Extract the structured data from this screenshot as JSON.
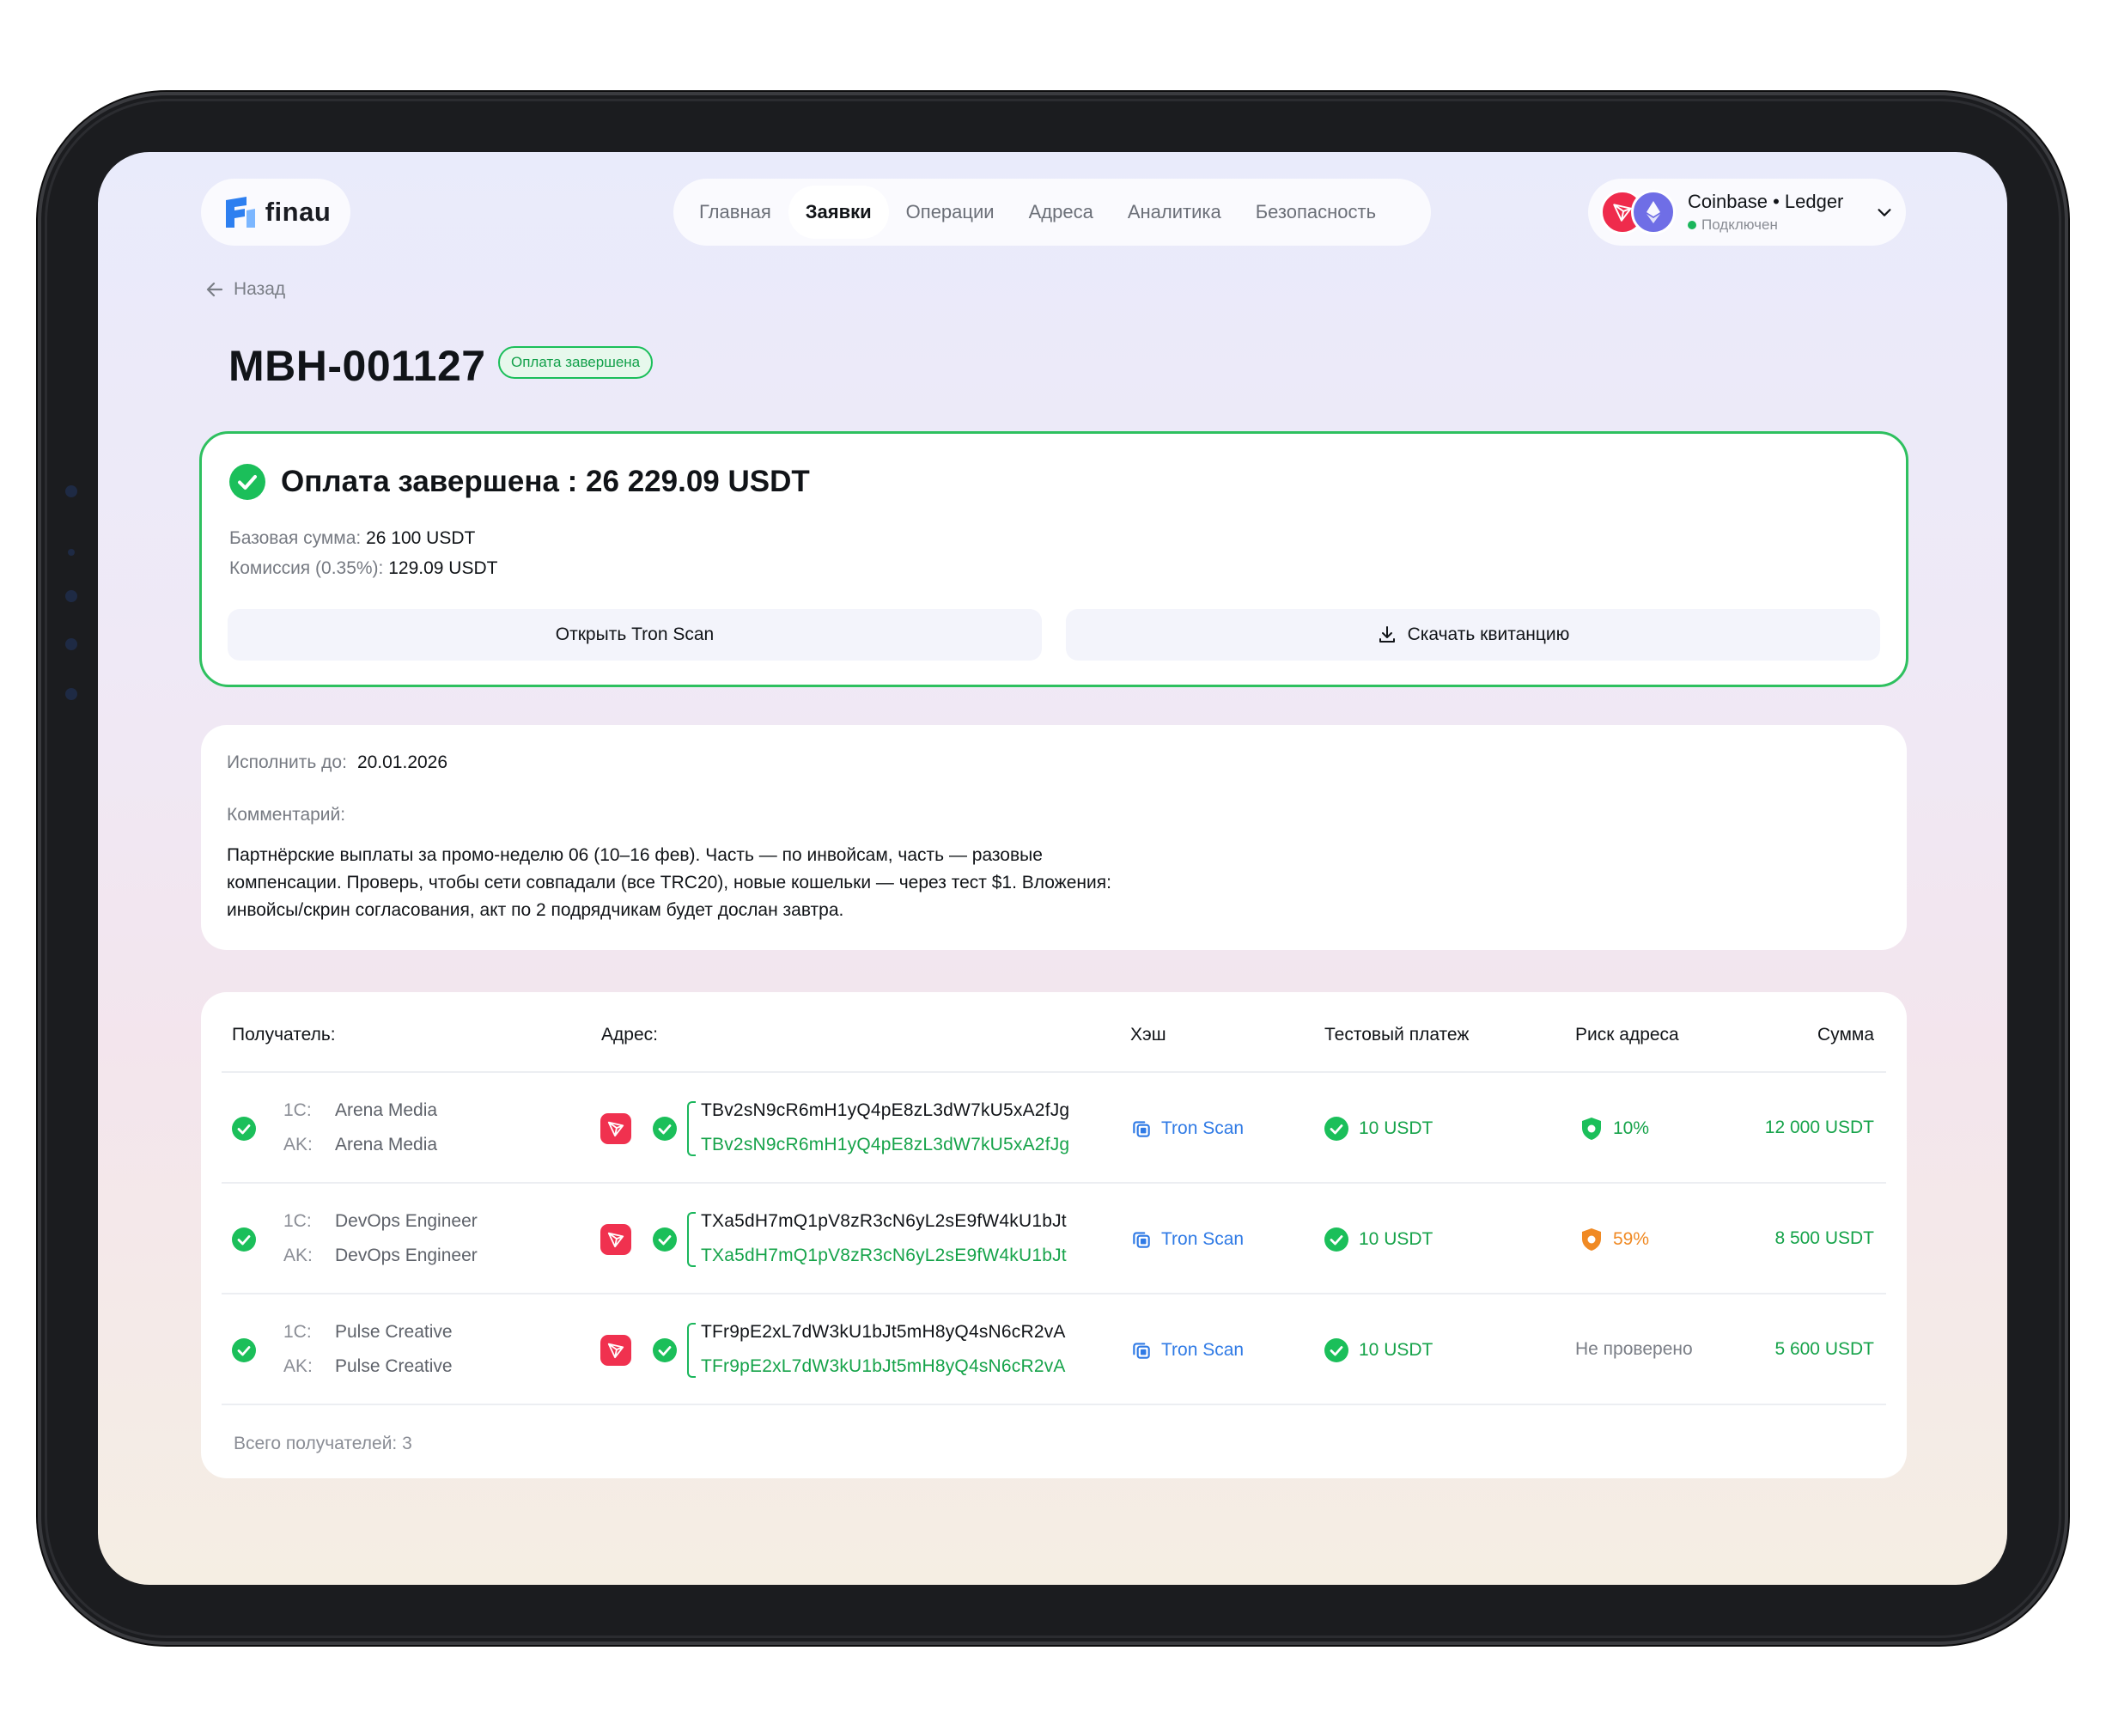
{
  "header": {
    "logo_text": "finau",
    "nav": [
      "Главная",
      "Заявки",
      "Операции",
      "Адреса",
      "Аналитика",
      "Безопасность"
    ],
    "active_nav": "Заявки",
    "wallet": {
      "name": "Coinbase • Ledger",
      "status": "Подключен"
    }
  },
  "page": {
    "back_label": "Назад",
    "title": "MBH-001127",
    "status_badge": "Оплата завершена"
  },
  "summary": {
    "title": "Оплата завершена : 26 229.09 USDT",
    "base_label": "Базовая сумма:",
    "base_value": "26 100 USDT",
    "fee_label": "Комиссия (0.35%):",
    "fee_value": "129.09 USDT",
    "btn_tronscan": "Открыть Tron Scan",
    "btn_receipt": "Скачать квитанцию"
  },
  "info": {
    "due_label": "Исполнить до:",
    "due_value": "20.01.2026",
    "comment_label": "Комментарий:",
    "comment_lines": [
      "Партнёрские выплаты за промо-неделю 06 (10–16 фев). Часть — по инвойсам, часть — разовые",
      "компенсации. Проверь, чтобы сети совпадали (все TRC20), новые кошельки — через тест $1. Вложения:",
      "инвойсы/скрин согласования, акт по 2 подрядчикам будет дослан завтра."
    ]
  },
  "table": {
    "headers": {
      "recipient": "Получатель:",
      "address": "Адрес:",
      "hash": "Хэш",
      "test": "Тестовый платеж",
      "risk": "Риск адреса",
      "amount": "Сумма"
    },
    "label_1c": "1C:",
    "label_ak": "AK:",
    "rows": [
      {
        "name_1c": "Arena Media",
        "name_ak": "Arena Media",
        "addr_1": "TBv2sN9cR6mH1yQ4pE8zL3dW7kU5xA2fJg",
        "addr_2": "TBv2sN9cR6mH1yQ4pE8zL3dW7kU5xA2fJg",
        "hash": "Tron Scan",
        "test": "10 USDT",
        "risk": "10%",
        "risk_level": "low",
        "amount": "12 000 USDT"
      },
      {
        "name_1c": "DevOps Engineer",
        "name_ak": "DevOps Engineer",
        "addr_1": "TXa5dH7mQ1pV8zR3cN6yL2sE9fW4kU1bJt",
        "addr_2": "TXa5dH7mQ1pV8zR3cN6yL2sE9fW4kU1bJt",
        "hash": "Tron Scan",
        "test": "10 USDT",
        "risk": "59%",
        "risk_level": "medium",
        "amount": "8 500 USDT"
      },
      {
        "name_1c": "Pulse Creative",
        "name_ak": "Pulse Creative",
        "addr_1": "TFr9pE2xL7dW3kU1bJt5mH8yQ4sN6cR2vA",
        "addr_2": "TFr9pE2xL7dW3kU1bJt5mH8yQ4sN6cR2vA",
        "hash": "Tron Scan",
        "test": "10 USDT",
        "risk": "Не проверено",
        "risk_level": "none",
        "amount": "5 600 USDT"
      }
    ],
    "total": "Всего получателей: 3"
  },
  "colors": {
    "success": "#1bb65c",
    "link": "#2f7ae5",
    "warning": "#f08a24",
    "tron": "#f0314f"
  }
}
